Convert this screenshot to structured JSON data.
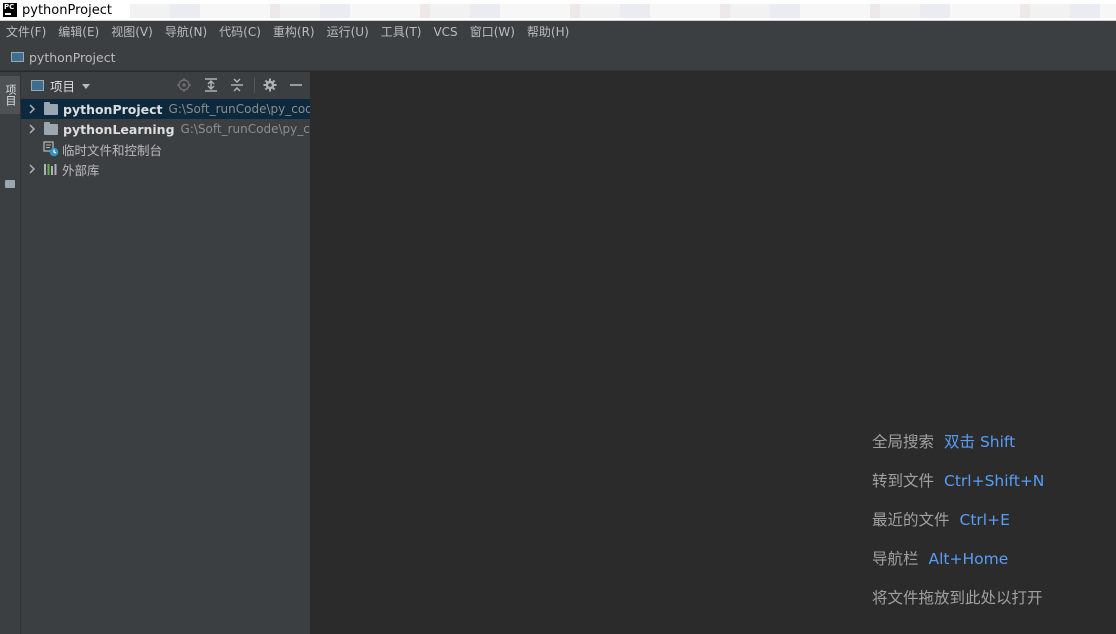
{
  "window": {
    "title": "pythonProject",
    "logo_text": "PC"
  },
  "menu": [
    "文件(F)",
    "编辑(E)",
    "视图(V)",
    "导航(N)",
    "代码(C)",
    "重构(R)",
    "运行(U)",
    "工具(T)",
    "VCS",
    "窗口(W)",
    "帮助(H)"
  ],
  "navbar": {
    "project": "pythonProject"
  },
  "left_strip": {
    "project_tab": "项目"
  },
  "panel": {
    "title": "项目"
  },
  "tree": {
    "rows": [
      {
        "label": "pythonProject",
        "path": "G:\\Soft_runCode\\py_code"
      },
      {
        "label": "pythonLearning",
        "path": "G:\\Soft_runCode\\py_code"
      },
      {
        "label": "临时文件和控制台"
      },
      {
        "label": "外部库"
      }
    ]
  },
  "hints": [
    {
      "text": "全局搜索",
      "key": "双击 Shift"
    },
    {
      "text": "转到文件",
      "key": "Ctrl+Shift+N"
    },
    {
      "text": "最近的文件",
      "key": "Ctrl+E"
    },
    {
      "text": "导航栏",
      "key": "Alt+Home"
    },
    {
      "text": "将文件拖放到此处以打开",
      "key": ""
    }
  ],
  "colors": {
    "editor_bg": "#2b2b2b",
    "panel_bg": "#3c3f41",
    "selection": "#0d293e",
    "key_accent": "#589df6"
  }
}
